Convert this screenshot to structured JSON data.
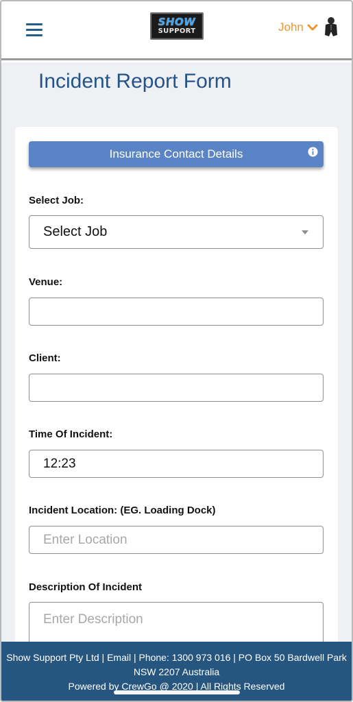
{
  "header": {
    "logo": {
      "line1": "SHOW",
      "line2": "SUPPORT"
    },
    "user_name": "John"
  },
  "page": {
    "title": "Incident Report Form"
  },
  "insurance_button": {
    "label": "Insurance Contact Details"
  },
  "form": {
    "select_job": {
      "label": "Select Job:",
      "value": "Select Job"
    },
    "venue": {
      "label": "Venue:",
      "value": ""
    },
    "client": {
      "label": "Client:",
      "value": ""
    },
    "time": {
      "label": "Time Of Incident:",
      "value": "12:23"
    },
    "location": {
      "label": "Incident Location: (EG. Loading Dock)",
      "placeholder": "Enter Location"
    },
    "description": {
      "label": "Description Of Incident",
      "placeholder": "Enter Description"
    }
  },
  "footer": {
    "line1": "Show Support Pty Ltd | Email | Phone: 1300 973 016 | PO Box 50 Bardwell Park",
    "line2": "NSW 2207 Australia",
    "line3": "Powered by CrewGo @ 2020 | All Rights Reserved"
  },
  "colors": {
    "brand_blue": "#24548a",
    "button_blue": "#5b84c7",
    "footer_blue": "#26567f",
    "user_orange": "#f0952f"
  }
}
